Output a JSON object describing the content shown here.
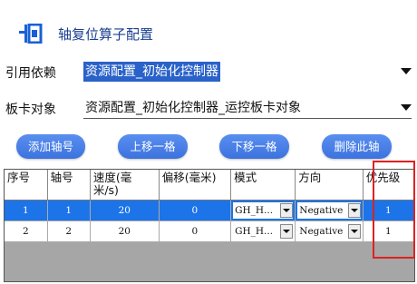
{
  "header": {
    "title": "轴复位算子配置",
    "icon": "reset-axis-icon"
  },
  "form": {
    "ref_label": "引用依赖",
    "ref_value": "资源配置_初始化控制器",
    "card_label": "板卡对象",
    "card_value": "资源配置_初始化控制器_运控板卡对象"
  },
  "buttons": {
    "add": "添加轴号",
    "up": "上移一格",
    "down": "下移一格",
    "delete": "删除此轴"
  },
  "table": {
    "headers": [
      "序号",
      "轴号",
      "速度(毫米/s)",
      "偏移(毫米)",
      "模式",
      "方向",
      "优先级"
    ],
    "rows": [
      {
        "seq": "1",
        "axis": "1",
        "speed": "20",
        "offset": "0",
        "mode": "GH_H...",
        "direction": "Negative",
        "priority": "1"
      },
      {
        "seq": "2",
        "axis": "2",
        "speed": "20",
        "offset": "0",
        "mode": "GH_H...",
        "direction": "Negative",
        "priority": "1"
      }
    ]
  },
  "colors": {
    "accent": "#2a62c9",
    "selected_row": "#1c74e8",
    "highlight_box": "#e02020"
  }
}
